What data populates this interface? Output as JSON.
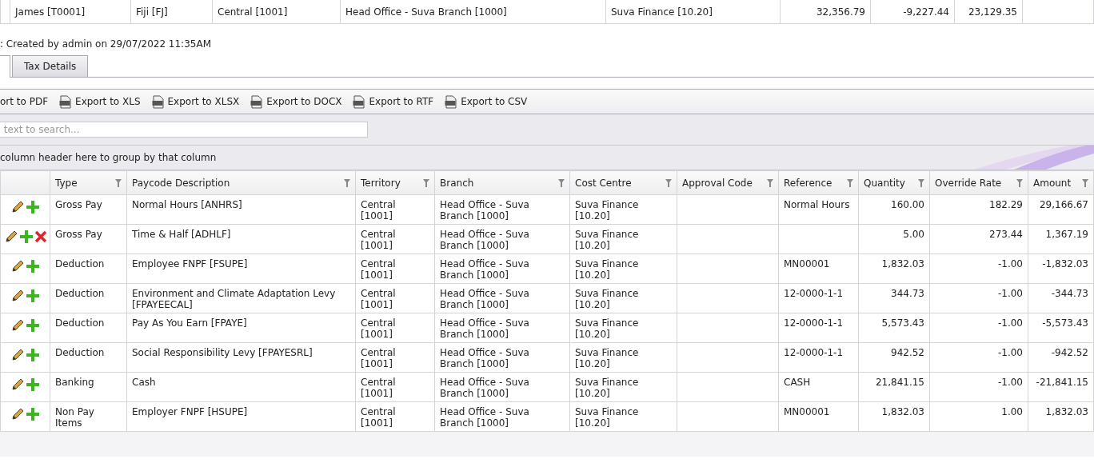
{
  "top_row": {
    "cells": [
      "James [T0001]",
      "Fiji [FJ]",
      "Central [1001]",
      "Head Office - Suva Branch [1000]",
      "Suva Finance [10.20]",
      "32,356.79",
      "-9,227.44",
      "23,129.35"
    ]
  },
  "info": ": Created by admin on 29/07/2022 11:35AM",
  "tabs": [
    {
      "selected": true
    },
    {
      "label": "Tax Details",
      "selected": false
    }
  ],
  "toolbar": [
    "ort to PDF",
    "Export to XLS",
    "Export to XLSX",
    "Export to DOCX",
    "Export to RTF",
    "Export to CSV"
  ],
  "search": {
    "placeholder": " text to search..."
  },
  "group_panel": "column header here to group by that column",
  "columns": [
    "Type",
    "Paycode Description",
    "Territory",
    "Branch",
    "Cost Centre",
    "Approval Code",
    "Reference",
    "Quantity",
    "Override Rate",
    "Amount"
  ],
  "rows": [
    {
      "deletable": false,
      "cells": [
        "Gross Pay",
        "Normal Hours [ANHRS]",
        "Central [1001]",
        "Head Office - Suva Branch [1000]",
        "Suva Finance [10.20]",
        "",
        "Normal Hours",
        "160.00",
        "182.29",
        "29,166.67"
      ]
    },
    {
      "deletable": true,
      "cells": [
        "Gross Pay",
        "Time & Half [ADHLF]",
        "Central [1001]",
        "Head Office - Suva Branch [1000]",
        "Suva Finance [10.20]",
        "",
        "",
        "5.00",
        "273.44",
        "1,367.19"
      ]
    },
    {
      "deletable": false,
      "cells": [
        "Deduction",
        "Employee FNPF [FSUPE]",
        "Central [1001]",
        "Head Office - Suva Branch [1000]",
        "Suva Finance [10.20]",
        "",
        "MN00001",
        "1,832.03",
        "-1.00",
        "-1,832.03"
      ]
    },
    {
      "deletable": false,
      "cells": [
        "Deduction",
        "Environment and Climate Adaptation Levy [FPAYEECAL]",
        "Central [1001]",
        "Head Office - Suva Branch [1000]",
        "Suva Finance [10.20]",
        "",
        "12-0000-1-1",
        "344.73",
        "-1.00",
        "-344.73"
      ]
    },
    {
      "deletable": false,
      "cells": [
        "Deduction",
        "Pay As You Earn [FPAYE]",
        "Central [1001]",
        "Head Office - Suva Branch [1000]",
        "Suva Finance [10.20]",
        "",
        "12-0000-1-1",
        "5,573.43",
        "-1.00",
        "-5,573.43"
      ]
    },
    {
      "deletable": false,
      "cells": [
        "Deduction",
        "Social Responsibility Levy [FPAYESRL]",
        "Central [1001]",
        "Head Office - Suva Branch [1000]",
        "Suva Finance [10.20]",
        "",
        "12-0000-1-1",
        "942.52",
        "-1.00",
        "-942.52"
      ]
    },
    {
      "deletable": false,
      "cells": [
        "Banking",
        "Cash",
        "Central [1001]",
        "Head Office - Suva Branch [1000]",
        "Suva Finance [10.20]",
        "",
        "CASH",
        "21,841.15",
        "-1.00",
        "-21,841.15"
      ]
    },
    {
      "deletable": false,
      "cells": [
        "Non Pay Items",
        "Employer FNPF [HSUPE]",
        "Central [1001]",
        "Head Office - Suva Branch [1000]",
        "Suva Finance [10.20]",
        "",
        "MN00001",
        "1,832.03",
        "1.00",
        "1,832.03"
      ]
    }
  ]
}
